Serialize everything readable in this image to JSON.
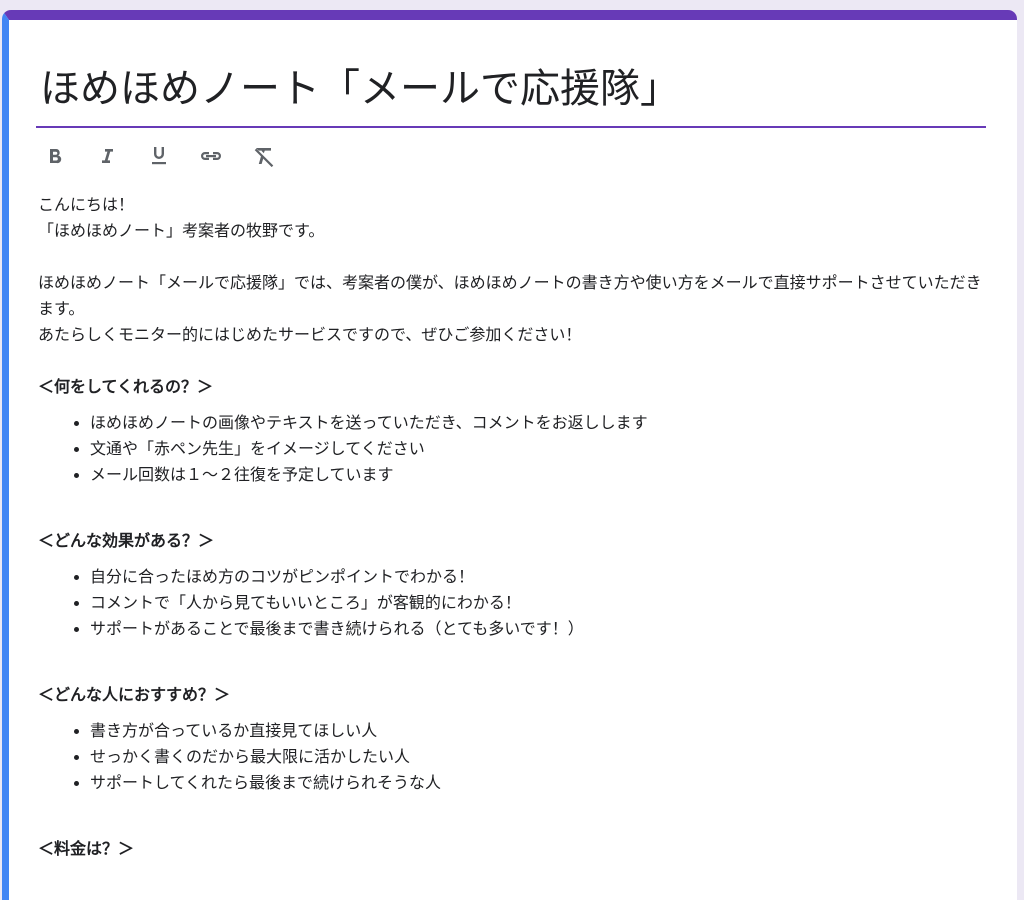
{
  "form": {
    "title": "ほめほめノート「メールで応援隊」",
    "toolbar": {
      "bold_icon": "bold-icon",
      "italic_icon": "italic-icon",
      "underline_icon": "underline-icon",
      "link_icon": "link-icon",
      "clear_format_icon": "clear-format-icon"
    },
    "intro": {
      "line1": "こんにちは！",
      "line2": "「ほめほめノート」考案者の牧野です。",
      "para1": "ほめほめノート「メールで応援隊」では、考案者の僕が、ほめほめノートの書き方や使い方をメールで直接サポートさせていただきます。",
      "para2": "あたらしくモニター的にはじめたサービスですので、ぜひご参加ください！"
    },
    "sections": [
      {
        "heading": "＜何をしてくれるの？＞",
        "items": [
          "ほめほめノートの画像やテキストを送っていただき、コメントをお返しします",
          "文通や「赤ペン先生」をイメージしてください",
          "メール回数は１〜２往復を予定しています"
        ]
      },
      {
        "heading": "＜どんな効果がある？＞",
        "items": [
          "自分に合ったほめ方のコツがピンポイントでわかる！",
          "コメントで「人から見てもいいところ」が客観的にわかる！",
          "サポートがあることで最後まで書き続けられる（とても多いです！）"
        ]
      },
      {
        "heading": "＜どんな人におすすめ？＞",
        "items": [
          "書き方が合っているか直接見てほしい人",
          "せっかく書くのだから最大限に活かしたい人",
          "サポートしてくれたら最後まで続けられそうな人"
        ]
      },
      {
        "heading": "＜料金は？＞",
        "items": []
      }
    ],
    "colors": {
      "accent": "#673ab7",
      "focus_bar": "#4285f4"
    }
  }
}
